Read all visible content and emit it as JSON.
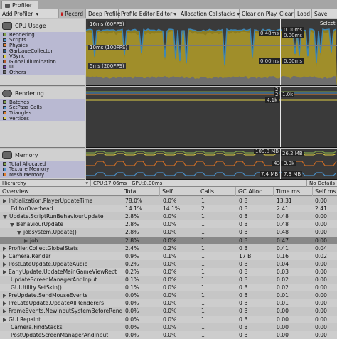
{
  "window": {
    "tab_title": "Profiler"
  },
  "toolbar": {
    "add_profiler": "Add Profiler",
    "record": "Record",
    "deep_profile": "Deep Profile",
    "profile_editor": "Profile Editor",
    "editor": "Editor",
    "allocation_callstacks": "Allocation Callstacks",
    "clear_on_play": "Clear on Play",
    "clear": "Clear",
    "load": "Load",
    "save": "Save"
  },
  "cpu": {
    "title": "CPU Usage",
    "legend": [
      {
        "label": "Rendering",
        "color": "#7fa14a"
      },
      {
        "label": "Scripts",
        "color": "#4b91c9"
      },
      {
        "label": "Physics",
        "color": "#e27e2d"
      },
      {
        "label": "GarbageCollector",
        "color": "#315e87"
      },
      {
        "label": "VSync",
        "color": "#e0cf45"
      },
      {
        "label": "Global Illumination",
        "color": "#b5582c"
      },
      {
        "label": "UI",
        "color": "#6b3c9e"
      },
      {
        "label": "Others",
        "color": "#646464"
      }
    ],
    "ref_16": "16ms (60FPS)",
    "ref_10": "10ms (100FPS)",
    "ref_5": "5ms (200FPS)",
    "select_hint": "Select",
    "val_1": "0.48ms",
    "val_2": "0.00ms",
    "val_3": "0.00ms",
    "val_4": "0.00ms",
    "val_5": "0.00ms"
  },
  "rendering": {
    "title": "Rendering",
    "legend": [
      {
        "label": "Batches",
        "color": "#7fa14a"
      },
      {
        "label": "SetPass Calls",
        "color": "#4b91c9"
      },
      {
        "label": "Triangles",
        "color": "#e27e2d"
      },
      {
        "label": "Vertices",
        "color": "#e0cf45"
      }
    ],
    "val_1": "2",
    "val_2": "2",
    "val_3": "1.0k",
    "val_4": "4.1k"
  },
  "memory": {
    "title": "Memory",
    "legend": [
      {
        "label": "Total Allocated",
        "color": "#7fa14a"
      },
      {
        "label": "Texture Memory",
        "color": "#4b91c9"
      },
      {
        "label": "Mesh Memory",
        "color": "#e27e2d"
      }
    ],
    "val_1": "109.8 MB",
    "val_2": "26.2 MB",
    "val_3": "43",
    "val_4": "3.0k",
    "val_5": "7.4 MB",
    "val_6": "7.3 MB"
  },
  "hierarchy": {
    "view": "Hierarchy",
    "cpu": "CPU:17.06ms",
    "gpu": "GPU:0.00ms",
    "details": "No Details",
    "columns": [
      "Overview",
      "Total",
      "Self",
      "Calls",
      "GC Alloc",
      "Time ms",
      "Self ms"
    ],
    "rows": [
      {
        "name": "Initialization.PlayerUpdateTime",
        "total": "78.0%",
        "self": "0.0%",
        "calls": "1",
        "gc": "0 B",
        "time": "13.31",
        "selfms": "0.00",
        "indent": 0,
        "arrow": "r"
      },
      {
        "name": "EditorOverhead",
        "total": "14.1%",
        "self": "14.1%",
        "calls": "2",
        "gc": "0 B",
        "time": "2.41",
        "selfms": "2.41",
        "indent": 0,
        "arrow": ""
      },
      {
        "name": "Update.ScriptRunBehaviourUpdate",
        "total": "2.8%",
        "self": "0.0%",
        "calls": "1",
        "gc": "0 B",
        "time": "0.48",
        "selfms": "0.00",
        "indent": 0,
        "arrow": "d"
      },
      {
        "name": "BehaviourUpdate",
        "total": "2.8%",
        "self": "0.0%",
        "calls": "1",
        "gc": "0 B",
        "time": "0.48",
        "selfms": "0.00",
        "indent": 1,
        "arrow": "d"
      },
      {
        "name": "jobsystem.Update()",
        "total": "2.8%",
        "self": "0.0%",
        "calls": "1",
        "gc": "0 B",
        "time": "0.48",
        "selfms": "0.00",
        "indent": 2,
        "arrow": "d"
      },
      {
        "name": "job",
        "total": "2.8%",
        "self": "0.0%",
        "calls": "1",
        "gc": "0 B",
        "time": "0.47",
        "selfms": "0.00",
        "indent": 3,
        "arrow": "r",
        "selected": true
      },
      {
        "name": "Profiler.CollectGlobalStats",
        "total": "2.4%",
        "self": "0.2%",
        "calls": "1",
        "gc": "0 B",
        "time": "0.41",
        "selfms": "0.04",
        "indent": 0,
        "arrow": "r"
      },
      {
        "name": "Camera.Render",
        "total": "0.9%",
        "self": "0.1%",
        "calls": "1",
        "gc": "17 B",
        "time": "0.16",
        "selfms": "0.02",
        "indent": 0,
        "arrow": "r"
      },
      {
        "name": "PostLateUpdate.UpdateAudio",
        "total": "0.2%",
        "self": "0.0%",
        "calls": "1",
        "gc": "0 B",
        "time": "0.04",
        "selfms": "0.00",
        "indent": 0,
        "arrow": "r"
      },
      {
        "name": "EarlyUpdate.UpdateMainGameViewRect",
        "total": "0.2%",
        "self": "0.0%",
        "calls": "1",
        "gc": "0 B",
        "time": "0.03",
        "selfms": "0.00",
        "indent": 0,
        "arrow": "r"
      },
      {
        "name": "UpdateScreenManagerAndInput",
        "total": "0.1%",
        "self": "0.0%",
        "calls": "1",
        "gc": "0 B",
        "time": "0.02",
        "selfms": "0.00",
        "indent": 0,
        "arrow": ""
      },
      {
        "name": "GUIUtility.SetSkin()",
        "total": "0.1%",
        "self": "0.0%",
        "calls": "1",
        "gc": "0 B",
        "time": "0.02",
        "selfms": "0.00",
        "indent": 0,
        "arrow": ""
      },
      {
        "name": "PreUpdate.SendMouseEvents",
        "total": "0.0%",
        "self": "0.0%",
        "calls": "1",
        "gc": "0 B",
        "time": "0.01",
        "selfms": "0.00",
        "indent": 0,
        "arrow": "r"
      },
      {
        "name": "PreLateUpdate.UpdateAllRenderers",
        "total": "0.0%",
        "self": "0.0%",
        "calls": "1",
        "gc": "0 B",
        "time": "0.01",
        "selfms": "0.00",
        "indent": 0,
        "arrow": "r"
      },
      {
        "name": "FrameEvents.NewInputSystemBeforeRend",
        "total": "0.0%",
        "self": "0.0%",
        "calls": "1",
        "gc": "0 B",
        "time": "0.00",
        "selfms": "0.00",
        "indent": 0,
        "arrow": "r"
      },
      {
        "name": "GUI.Repaint",
        "total": "0.0%",
        "self": "0.0%",
        "calls": "1",
        "gc": "0 B",
        "time": "0.00",
        "selfms": "0.00",
        "indent": 0,
        "arrow": "r"
      },
      {
        "name": "Camera.FindStacks",
        "total": "0.0%",
        "self": "0.0%",
        "calls": "1",
        "gc": "0 B",
        "time": "0.00",
        "selfms": "0.00",
        "indent": 0,
        "arrow": ""
      },
      {
        "name": "PostUpdateScreenManagerAndInput",
        "total": "0.0%",
        "self": "0.0%",
        "calls": "1",
        "gc": "0 B",
        "time": "0.00",
        "selfms": "0.00",
        "indent": 0,
        "arrow": ""
      }
    ]
  }
}
